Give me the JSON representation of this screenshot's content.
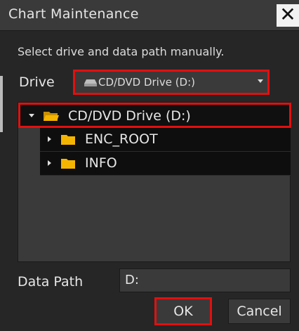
{
  "dialog": {
    "title": "Chart Maintenance",
    "close_icon": "close-icon"
  },
  "instructions": "Select drive and data path manually.",
  "drive": {
    "label": "Drive",
    "selected": "CD/DVD Drive (D:)",
    "icon": "drive-icon"
  },
  "tree": {
    "root": {
      "label": "CD/DVD Drive (D:)",
      "icon": "folder-open-icon"
    },
    "children": [
      {
        "label": "ENC_ROOT",
        "icon": "folder-icon"
      },
      {
        "label": "INFO",
        "icon": "folder-icon"
      }
    ]
  },
  "data_path": {
    "label": "Data Path",
    "value": "D:"
  },
  "buttons": {
    "ok": "OK",
    "cancel": "Cancel"
  },
  "colors": {
    "highlight": "#e11010",
    "folder": "#f5b400",
    "background": "#262626"
  }
}
